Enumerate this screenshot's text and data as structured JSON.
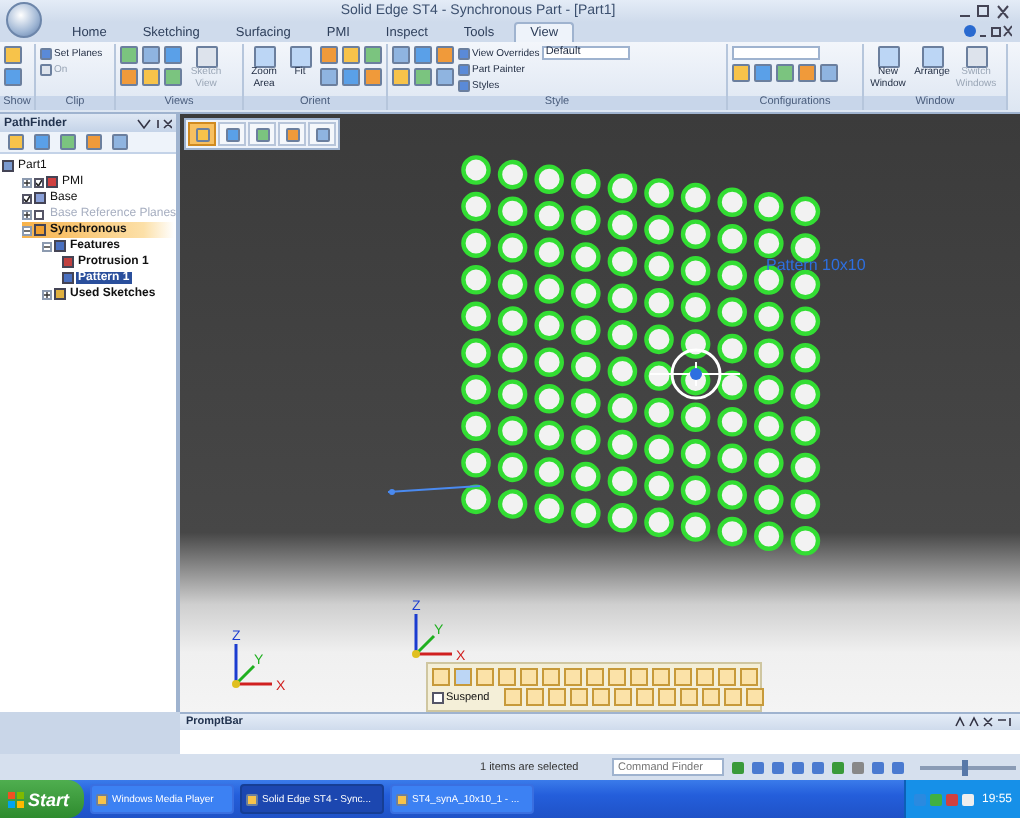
{
  "window": {
    "title": "Solid Edge ST4 - Synchronous Part - [Part1]"
  },
  "ribbon_tabs": [
    {
      "label": "Home",
      "selected": false
    },
    {
      "label": "Sketching",
      "selected": false
    },
    {
      "label": "Surfacing",
      "selected": false
    },
    {
      "label": "PMI",
      "selected": false
    },
    {
      "label": "Inspect",
      "selected": false
    },
    {
      "label": "Tools",
      "selected": false
    },
    {
      "label": "View",
      "selected": true
    }
  ],
  "ribbon_groups": [
    {
      "label": "Show"
    },
    {
      "label": "Clip",
      "buttons": [
        {
          "label": "Set Planes",
          "kind": "small",
          "disabled": false
        },
        {
          "label": "On",
          "kind": "small",
          "disabled": true
        }
      ]
    },
    {
      "label": "Views",
      "buttons": [
        {
          "label": "Sketch View",
          "kind": "large",
          "disabled": true
        }
      ]
    },
    {
      "label": "Orient",
      "buttons": [
        {
          "label": "Zoom Area",
          "kind": "large",
          "disabled": false
        },
        {
          "label": "Fit",
          "kind": "large",
          "disabled": false
        }
      ]
    },
    {
      "label": "Style",
      "buttons": [
        {
          "label": "View Overrides",
          "kind": "small",
          "disabled": false
        },
        {
          "label": "Part Painter",
          "kind": "small",
          "disabled": false
        },
        {
          "label": "Styles",
          "kind": "small",
          "disabled": false
        }
      ],
      "dropdown": "Default"
    },
    {
      "label": "Configurations"
    },
    {
      "label": "Window",
      "buttons": [
        {
          "label": "New Window",
          "kind": "large",
          "disabled": false
        },
        {
          "label": "Arrange",
          "kind": "large",
          "disabled": false
        },
        {
          "label": "Switch Windows",
          "kind": "large",
          "disabled": true
        }
      ]
    }
  ],
  "pathfinder": {
    "title": "PathFinder",
    "tree": [
      {
        "label": "Part1",
        "kind": "part",
        "selected": false,
        "children": [
          {
            "label": "PMI",
            "kind": "pmi",
            "selected": false,
            "expanded": false,
            "checked": true
          },
          {
            "label": "Base",
            "kind": "body",
            "selected": false,
            "checked": true
          },
          {
            "label": "Base Reference Planes",
            "kind": "planes",
            "selected": false,
            "expanded": false,
            "checked": false
          },
          {
            "label": "Synchronous",
            "kind": "environment",
            "selected": false,
            "expanded": true,
            "children": [
              {
                "label": "Features",
                "kind": "collection",
                "selected": false,
                "expanded": true,
                "children": [
                  {
                    "label": "Protrusion 1",
                    "kind": "feature",
                    "selected": false
                  },
                  {
                    "label": "Pattern 1",
                    "kind": "pattern",
                    "selected": true
                  }
                ]
              },
              {
                "label": "Used Sketches",
                "kind": "sketches",
                "selected": false,
                "expanded": false
              }
            ]
          }
        ]
      }
    ]
  },
  "view_toolbar": [
    {
      "selected": true
    },
    {
      "selected": false
    },
    {
      "selected": false
    },
    {
      "selected": false
    },
    {
      "selected": false
    }
  ],
  "canvas_label": "Pattern 10x10",
  "triads": [
    {
      "x": "X",
      "y": "Y",
      "z": "Z"
    },
    {
      "x": "X",
      "y": "Y",
      "z": "Z"
    }
  ],
  "command_bar": {
    "suspend": {
      "label": "Suspend",
      "checked": false
    }
  },
  "prompt_bar": {
    "title": "PromptBar"
  },
  "status_bar": {
    "message": "1 items are selected",
    "command_finder": {
      "placeholder": "Command Finder"
    },
    "zoom": {
      "level": 0.45
    }
  },
  "taskbar": {
    "start": "Start",
    "items": [
      {
        "label": "Windows Media Player",
        "selected": false
      },
      {
        "label": "Solid Edge ST4 - Sync...",
        "selected": true
      },
      {
        "label": "ST4_synA_10x10_1 - ...",
        "selected": false
      }
    ],
    "clock": "19:55"
  }
}
